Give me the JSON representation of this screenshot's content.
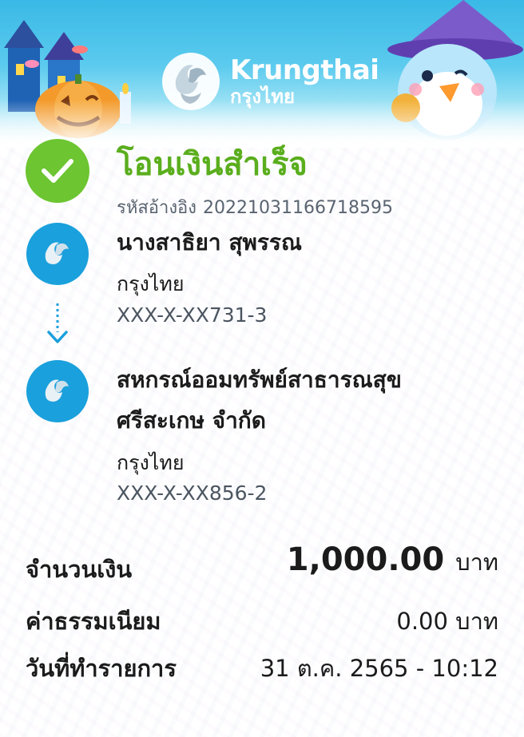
{
  "header": {
    "brand_en": "Krungthai",
    "brand_th": "กรุงไทย",
    "colors": {
      "sky": "#39b9e6",
      "brand_white": "#ffffff"
    }
  },
  "status": {
    "title": "โอนเงินสำเร็จ",
    "ref_label": "รหัสอ้างอิง",
    "ref_value": "20221031166718595",
    "icon": "check-icon",
    "color": "#6cc531"
  },
  "sender": {
    "name": "นางสาธิยา สุพรรณ",
    "bank": "กรุงไทย",
    "account": "XXX-X-XX731-3"
  },
  "receiver": {
    "name_line1": "สหกรณ์ออมทรัพย์สาธารณสุข",
    "name_line2": "ศรีสะเกษ จำกัด",
    "bank": "กรุงไทย",
    "account": "XXX-X-XX856-2"
  },
  "summary": {
    "amount_label": "จำนวนเงิน",
    "amount_value": "1,000.00",
    "amount_unit": "บาท",
    "fee_label": "ค่าธรรมเนียม",
    "fee_value": "0.00 บาท",
    "date_label": "วันที่ทำรายการ",
    "date_value": "31 ต.ค. 2565 - 10:12"
  }
}
